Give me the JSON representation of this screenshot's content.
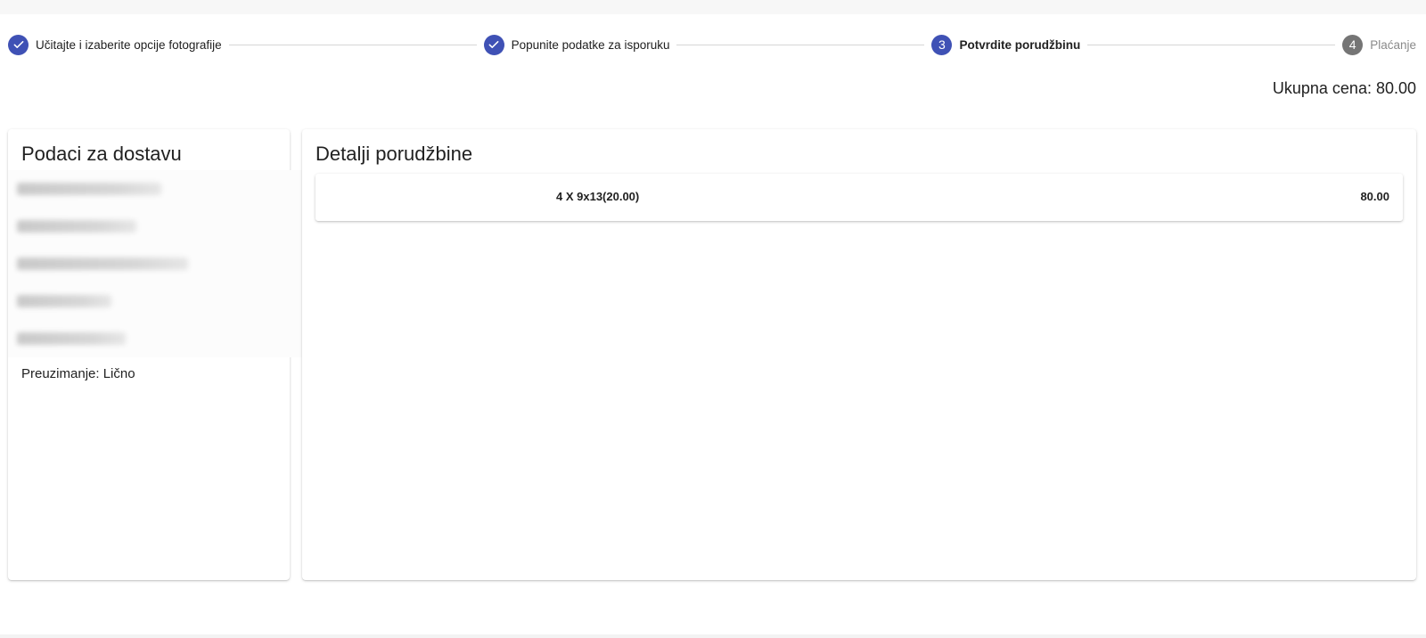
{
  "stepper": {
    "steps": [
      {
        "label": "Učitajte i izaberite opcije fotografije",
        "status": "completed",
        "number": "1"
      },
      {
        "label": "Popunite podatke za isporuku",
        "status": "completed",
        "number": "2"
      },
      {
        "label": "Potvrdite porudžbinu",
        "status": "active",
        "number": "3"
      },
      {
        "label": "Plaćanje",
        "status": "inactive",
        "number": "4"
      }
    ]
  },
  "total_label": "Ukupna cena: 80.00",
  "delivery": {
    "title": "Podaci za dostavu",
    "pickup": "Preuzimanje: Lično"
  },
  "order": {
    "title": "Detalji porudžbine",
    "items": [
      {
        "description": "4 X 9x13(20.00)",
        "price": "80.00"
      }
    ]
  },
  "colors": {
    "accent": "#3f51b5",
    "inactive": "#757575"
  }
}
